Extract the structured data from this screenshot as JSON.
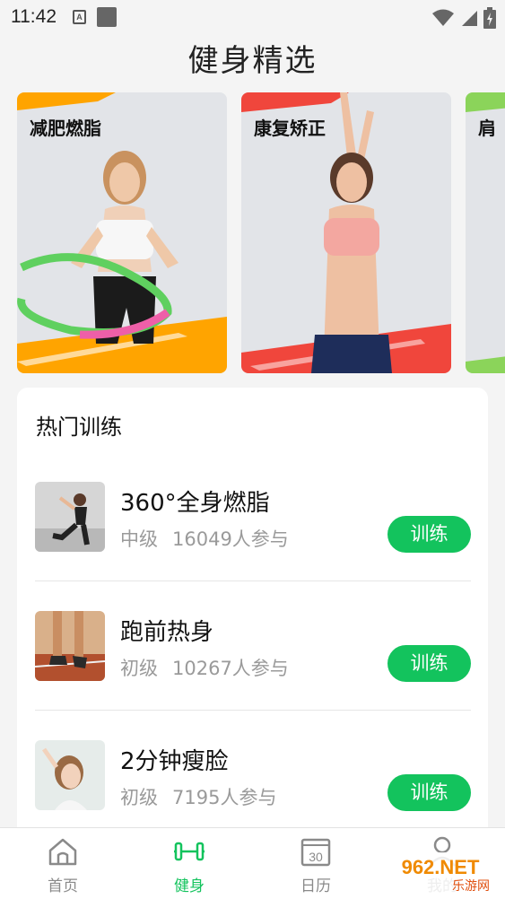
{
  "status_bar": {
    "time": "11:42",
    "icon_a": "A"
  },
  "page": {
    "title": "健身精选"
  },
  "cards": [
    {
      "label": "减肥燃脂",
      "accent": "#ffa400"
    },
    {
      "label": "康复矫正",
      "accent": "#f0463c"
    },
    {
      "label": "肩",
      "accent": "#8bd45a"
    }
  ],
  "hot": {
    "title": "热门训练",
    "items": [
      {
        "name": "360°全身燃脂",
        "level": "中级",
        "participants": "16049人参与",
        "button": "训练"
      },
      {
        "name": "跑前热身",
        "level": "初级",
        "participants": "10267人参与",
        "button": "训练"
      },
      {
        "name": "2分钟瘦脸",
        "level": "初级",
        "participants": "7195人参与",
        "button": "训练"
      }
    ]
  },
  "nav": {
    "items": [
      {
        "label": "首页",
        "icon": "home-icon",
        "active": false
      },
      {
        "label": "健身",
        "icon": "dumbbell-icon",
        "active": true
      },
      {
        "label": "日历",
        "icon": "calendar-icon",
        "active": false
      },
      {
        "label": "我的",
        "icon": "profile-icon",
        "active": false
      }
    ],
    "calendar_day": "30"
  },
  "watermark": {
    "text": "962.NET",
    "subtext": "乐游网"
  },
  "colors": {
    "accent_green": "#13c35d",
    "background": "#f4f4f4"
  }
}
